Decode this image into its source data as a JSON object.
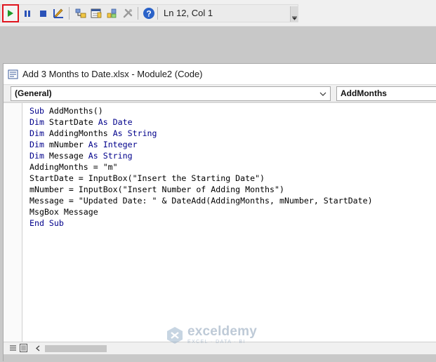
{
  "toolbar": {
    "status": "Ln 12, Col 1",
    "buttons": [
      "run-icon",
      "break-icon",
      "reset-icon",
      "design-mode-icon",
      "project-explorer-icon",
      "properties-icon",
      "object-browser-icon",
      "toolbox-icon",
      "help-icon"
    ]
  },
  "window": {
    "title": "Add 3 Months to Date.xlsx - Module2 (Code)",
    "object_combo": "(General)",
    "procedure_combo": "AddMonths"
  },
  "code": {
    "lines": [
      {
        "kw1": "Sub",
        "t1": " AddMonths()",
        "kw2": "",
        "t2": ""
      },
      {
        "kw1": "Dim",
        "t1": " StartDate ",
        "kw2": "As Date",
        "t2": ""
      },
      {
        "kw1": "Dim",
        "t1": " AddingMonths ",
        "kw2": "As String",
        "t2": ""
      },
      {
        "kw1": "Dim",
        "t1": " mNumber ",
        "kw2": "As Integer",
        "t2": ""
      },
      {
        "kw1": "Dim",
        "t1": " Message ",
        "kw2": "As String",
        "t2": ""
      },
      {
        "kw1": "",
        "t1": "AddingMonths = \"m\"",
        "kw2": "",
        "t2": ""
      },
      {
        "kw1": "",
        "t1": "StartDate = InputBox(\"Insert the Starting Date\")",
        "kw2": "",
        "t2": ""
      },
      {
        "kw1": "",
        "t1": "mNumber = InputBox(\"Insert Number of Adding Months\")",
        "kw2": "",
        "t2": ""
      },
      {
        "kw1": "",
        "t1": "Message = \"Updated Date: \" & DateAdd(AddingMonths, mNumber, StartDate)",
        "kw2": "",
        "t2": ""
      },
      {
        "kw1": "",
        "t1": "MsgBox Message",
        "kw2": "",
        "t2": ""
      },
      {
        "kw1": "End Sub",
        "t1": "",
        "kw2": "",
        "t2": ""
      }
    ]
  },
  "watermark": {
    "name": "exceldemy",
    "tagline": "EXCEL · DATA · BI"
  },
  "colors": {
    "keyword": "#00008b",
    "run_highlight": "#e0141e"
  }
}
